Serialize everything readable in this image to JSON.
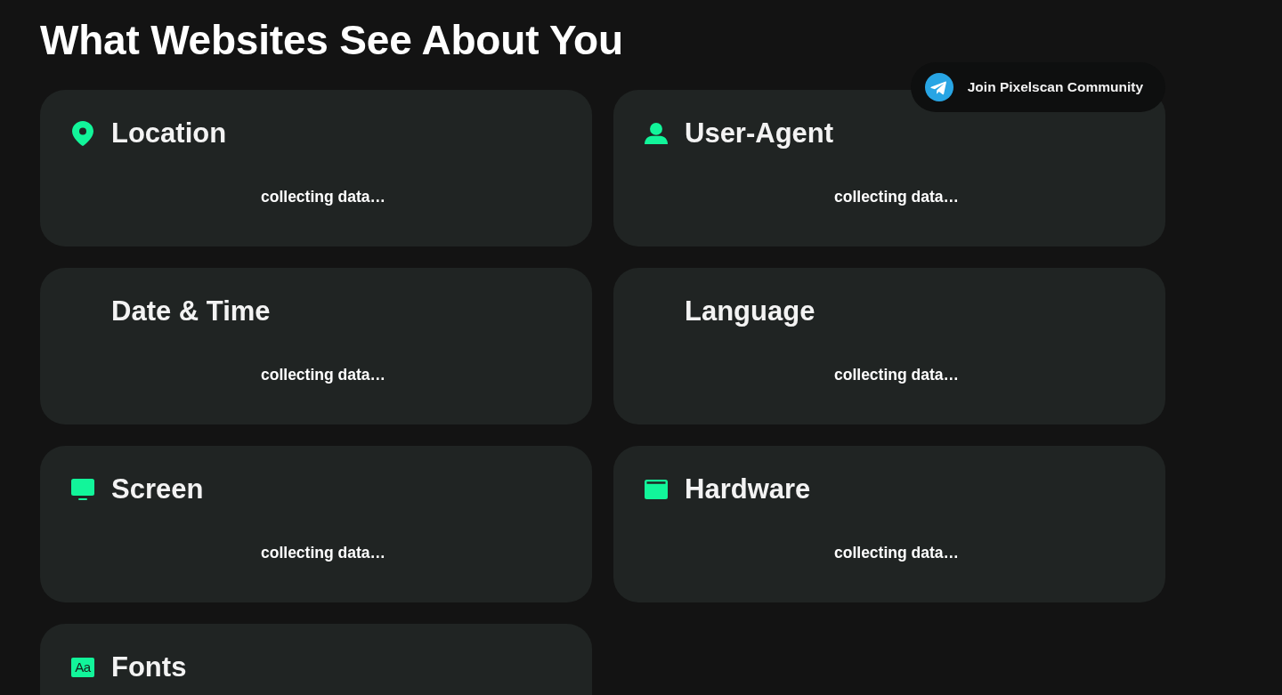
{
  "page_title": "What Websites See About You",
  "community_button": {
    "label": "Join Pixelscan Community"
  },
  "cards": [
    {
      "kind": "location",
      "title": "Location",
      "status": "collecting data…"
    },
    {
      "kind": "user-agent",
      "title": "User-Agent",
      "status": "collecting data…"
    },
    {
      "kind": "date-time",
      "title": "Date & Time",
      "status": "collecting data…"
    },
    {
      "kind": "language",
      "title": "Language",
      "status": "collecting data…"
    },
    {
      "kind": "screen",
      "title": "Screen",
      "status": "collecting data…"
    },
    {
      "kind": "hardware",
      "title": "Hardware",
      "status": "collecting data…"
    },
    {
      "kind": "fonts",
      "title": "Fonts",
      "icon_glyph": "Aa"
    }
  ]
}
